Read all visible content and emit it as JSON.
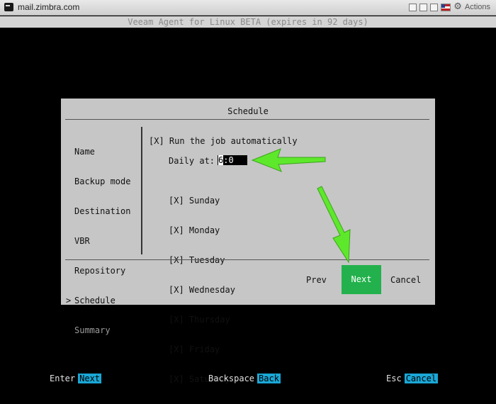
{
  "window": {
    "title": "mail.zimbra.com",
    "actions_label": "Actions",
    "icons": [
      "square-icon",
      "square-icon",
      "square-icon",
      "us-flag-icon",
      "gear-icon"
    ]
  },
  "terminal": {
    "header": "Veeam Agent for Linux BETA (expires in 92 days)"
  },
  "dialog": {
    "title": "Schedule",
    "steps": [
      {
        "label": "Name",
        "current": false,
        "disabled": false
      },
      {
        "label": "Backup mode",
        "current": false,
        "disabled": false
      },
      {
        "label": "Destination",
        "current": false,
        "disabled": false
      },
      {
        "label": "VBR",
        "current": false,
        "disabled": false
      },
      {
        "label": "Repository",
        "current": false,
        "disabled": false
      },
      {
        "label": "Schedule",
        "current": true,
        "disabled": false,
        "marker": ">"
      },
      {
        "label": "Summary",
        "current": false,
        "disabled": true
      }
    ],
    "run_auto": {
      "checkbox": "[X]",
      "label": "Run the job automatically"
    },
    "daily": {
      "label": "Daily at:",
      "value_caret": "6",
      "value_rest": ":0"
    },
    "days": [
      {
        "checkbox": "[X]",
        "label": "Sunday"
      },
      {
        "checkbox": "[X]",
        "label": "Monday"
      },
      {
        "checkbox": "[X]",
        "label": "Tuesday"
      },
      {
        "checkbox": "[X]",
        "label": "Wednesday"
      },
      {
        "checkbox": "[X]",
        "label": "Thursday"
      },
      {
        "checkbox": "[X]",
        "label": "Friday"
      },
      {
        "checkbox": "[X]",
        "label": "Saturday"
      }
    ],
    "buttons": {
      "prev": "Prev",
      "next": "Next",
      "cancel": "Cancel"
    }
  },
  "statusbar": {
    "enter_key": "Enter",
    "enter_action": "Next",
    "backspace_key": "Backspace",
    "backspace_action": "Back",
    "esc_key": "Esc",
    "esc_action": "Cancel"
  },
  "colors": {
    "terminal_bg": "#000000",
    "dialog_bg": "#c6c6c6",
    "next_button": "#22b14c",
    "status_action": "#1aa7d6",
    "annotation_arrow": "#5ee82b"
  }
}
